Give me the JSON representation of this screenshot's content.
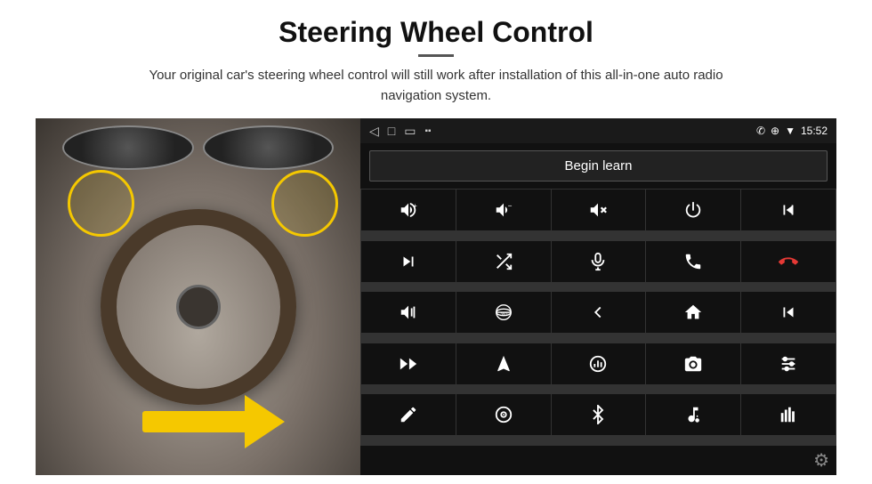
{
  "page": {
    "title": "Steering Wheel Control",
    "subtitle": "Your original car's steering wheel control will still work after installation of this all-in-one auto radio navigation system."
  },
  "status_bar": {
    "time": "15:52",
    "back_icon": "◁",
    "home_icon": "□",
    "recents_icon": "▫",
    "signal_icon": "▪▪",
    "phone_icon": "✆",
    "location_icon": "⊕",
    "wifi_icon": "▼"
  },
  "begin_learn_button": {
    "label": "Begin learn"
  },
  "icons_grid": [
    {
      "id": "vol-up",
      "symbol": "vol-up"
    },
    {
      "id": "vol-down",
      "symbol": "vol-down"
    },
    {
      "id": "vol-mute",
      "symbol": "vol-mute"
    },
    {
      "id": "power",
      "symbol": "power"
    },
    {
      "id": "prev-track",
      "symbol": "prev-track"
    },
    {
      "id": "skip-next",
      "symbol": "skip-next"
    },
    {
      "id": "shuffle",
      "symbol": "shuffle"
    },
    {
      "id": "mic",
      "symbol": "mic"
    },
    {
      "id": "phone",
      "symbol": "phone"
    },
    {
      "id": "hang-up",
      "symbol": "hang-up"
    },
    {
      "id": "horn",
      "symbol": "horn"
    },
    {
      "id": "360",
      "symbol": "360"
    },
    {
      "id": "back",
      "symbol": "back"
    },
    {
      "id": "home",
      "symbol": "home"
    },
    {
      "id": "skip-back",
      "symbol": "skip-back"
    },
    {
      "id": "fast-forward",
      "symbol": "fast-forward"
    },
    {
      "id": "navigate",
      "symbol": "navigate"
    },
    {
      "id": "eq",
      "symbol": "eq"
    },
    {
      "id": "camera",
      "symbol": "camera"
    },
    {
      "id": "settings-sliders",
      "symbol": "settings-sliders"
    },
    {
      "id": "pen",
      "symbol": "pen"
    },
    {
      "id": "cd",
      "symbol": "cd"
    },
    {
      "id": "bluetooth",
      "symbol": "bluetooth"
    },
    {
      "id": "music-settings",
      "symbol": "music-settings"
    },
    {
      "id": "equalizer",
      "symbol": "equalizer"
    }
  ],
  "settings": {
    "gear_icon": "⚙"
  }
}
